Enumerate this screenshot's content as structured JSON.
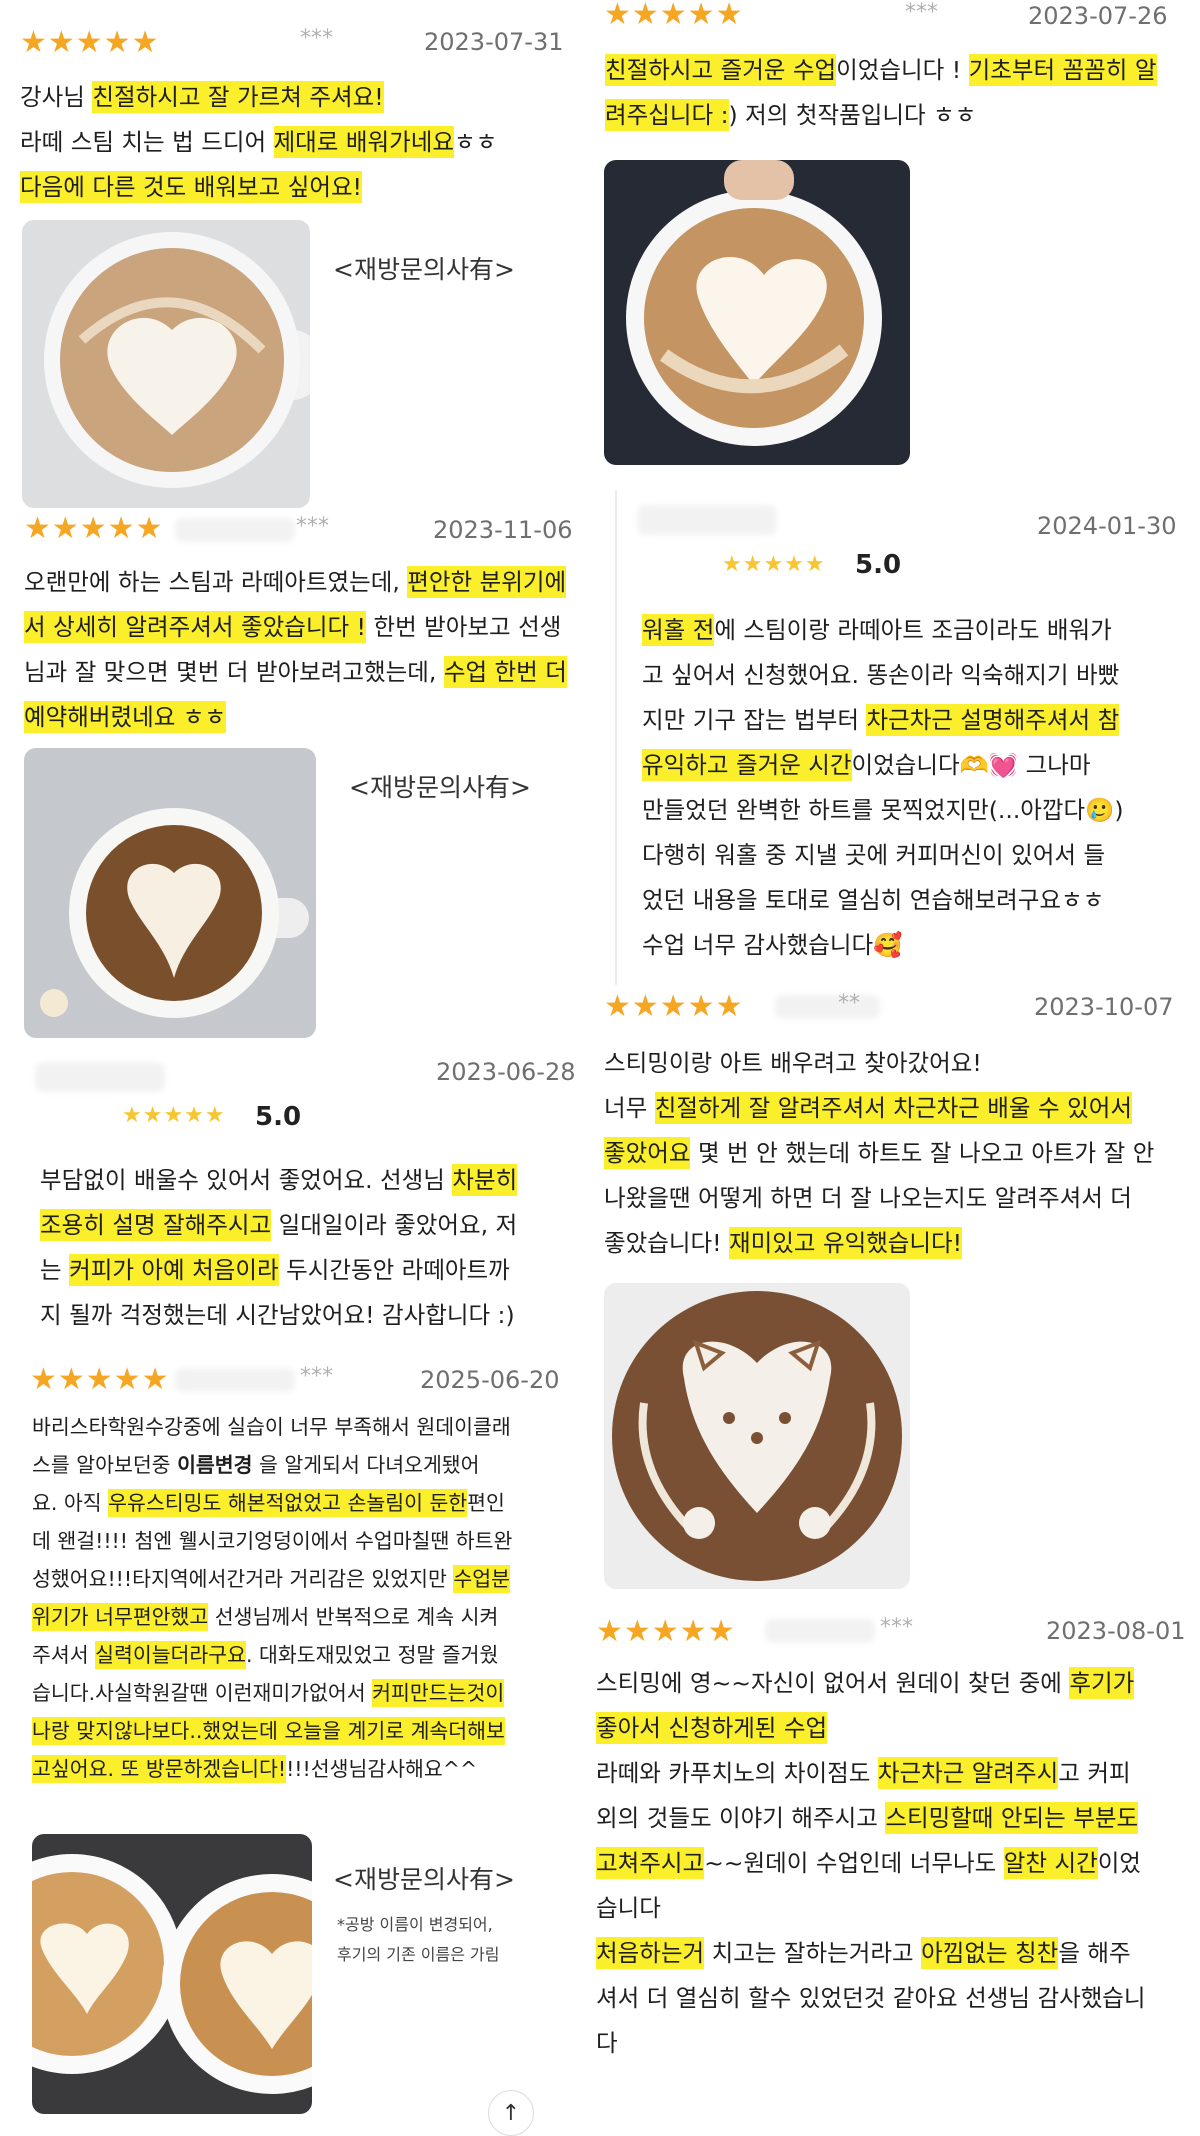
{
  "reviews": [
    {
      "stars": "★★★★★",
      "author": "***",
      "date": "2023-07-31",
      "lines": [
        [
          {
            "t": "강사님 "
          },
          {
            "t": "친절하시고 잘 가르쳐 주셔요!",
            "h": true
          }
        ],
        [
          {
            "t": "라떼 스팀 치는 법 드디어 "
          },
          {
            "t": "제대로 배워가네요",
            "h": true
          },
          {
            "t": "ㅎㅎ"
          }
        ],
        [
          {
            "t": "다음에 다른 것도 배워보고 싶어요!",
            "h": true
          }
        ]
      ],
      "note": "<재방문의사有>"
    },
    {
      "stars": "★★★★★",
      "author": "***",
      "date": "2023-07-26",
      "lines": [
        [
          {
            "t": "친절하시고 즐거운 수업",
            "h": true
          },
          {
            "t": "이었습니다 ! "
          },
          {
            "t": "기초부터 꼼꼼히 알",
            "h": true
          }
        ],
        [
          {
            "t": "려주십니다 :",
            "h": true
          },
          {
            "t": ") 저의 첫작품입니다 ㅎㅎ"
          }
        ]
      ]
    },
    {
      "stars": "★★★★★",
      "author": "***",
      "date": "2023-11-06",
      "lines": [
        [
          {
            "t": "오랜만에 하는 스팀과 라떼아트였는데, "
          },
          {
            "t": "편안한 분위기에",
            "h": true
          }
        ],
        [
          {
            "t": "서 상세히 알려주셔서 좋았습니다 !",
            "h": true
          },
          {
            "t": " 한번 받아보고 선생"
          }
        ],
        [
          {
            "t": "님과 잘 맞으면 몇번 더 받아보려고했는데, "
          },
          {
            "t": "수업 한번 더",
            "h": true
          }
        ],
        [
          {
            "t": "예약해버렸네요 ㅎㅎ",
            "h": true
          }
        ]
      ],
      "note": "<재방문의사有>"
    },
    {
      "stars": "★★★★★",
      "rating": "5.0",
      "date": "2024-01-30",
      "lines": [
        [
          {
            "t": "워홀 전",
            "h": true
          },
          {
            "t": "에 스팀이랑 라떼아트 조금이라도 배워가"
          }
        ],
        [
          {
            "t": "고 싶어서 신청했어요. 똥손이라 익숙해지기 바빴"
          }
        ],
        [
          {
            "t": "지만 기구 잡는 법부터 "
          },
          {
            "t": "차근차근 설명해주셔서 참",
            "h": true
          }
        ],
        [
          {
            "t": "유익하고 즐거운 시간",
            "h": true
          },
          {
            "t": "이었습니다🫶💓 그나마"
          }
        ],
        [
          {
            "t": "만들었던 완벽한 하트를 못찍었지만(...아깝다🥲)"
          }
        ],
        [
          {
            "t": "다행히 워홀 중 지낼 곳에 커피머신이 있어서 들"
          }
        ],
        [
          {
            "t": "었던 내용을 토대로 열심히 연습해보려구요ㅎㅎ"
          }
        ],
        [
          {
            "t": "수업 너무 감사했습니다🥰"
          }
        ]
      ]
    },
    {
      "stars": "★★★★★",
      "author": "**",
      "date": "2023-10-07",
      "lines": [
        [
          {
            "t": "스티밍이랑 아트 배우려고 찾아갔어요!"
          }
        ],
        [
          {
            "t": "너무 "
          },
          {
            "t": "친절하게 잘 알려주셔서 차근차근 배울 수 있어서",
            "h": true
          }
        ],
        [
          {
            "t": "좋았어요",
            "h": true
          },
          {
            "t": " 몇 번 안 했는데 하트도 잘 나오고 아트가 잘 안"
          }
        ],
        [
          {
            "t": "나왔을땐 어떻게 하면 더 잘 나오는지도 알려주셔서 더"
          }
        ],
        [
          {
            "t": "좋았습니다! "
          },
          {
            "t": "재미있고 유익했습니다!",
            "h": true
          }
        ]
      ]
    },
    {
      "stars": "★★★★★",
      "rating": "5.0",
      "date": "2023-06-28",
      "lines": [
        [
          {
            "t": "부담없이 배울수 있어서 좋었어요. 선생님 "
          },
          {
            "t": "차분히",
            "h": true
          }
        ],
        [
          {
            "t": "조용히 설명 잘해주시고",
            "h": true
          },
          {
            "t": " 일대일이라 좋았어요, 저"
          }
        ],
        [
          {
            "t": "는 "
          },
          {
            "t": "커피가 아예 처음이라",
            "h": true
          },
          {
            "t": " 두시간동안 라떼아트까"
          }
        ],
        [
          {
            "t": "지 될까 걱정했는데 시간남았어요! 감사합니다 :)"
          }
        ]
      ]
    },
    {
      "stars": "★★★★★",
      "author": "***",
      "date": "2025-06-20",
      "lines": [
        [
          {
            "t": "바리스타학원수강중에 실습이 너무 부족해서 원데이클래"
          }
        ],
        [
          {
            "t": "스를 알아보던중 "
          },
          {
            "t": "이름변경",
            "b": true
          },
          {
            "t": " 을 알게되서 다녀오게됐어"
          }
        ],
        [
          {
            "t": "요. 아직 "
          },
          {
            "t": "우유스티밍도 해본적없었고 손놀림이 둔한",
            "h": true
          },
          {
            "t": "편인"
          }
        ],
        [
          {
            "t": "데 왠걸!!!! 첨엔 웰시코기엉덩이에서 수업마칠땐 하트완"
          }
        ],
        [
          {
            "t": "성했어요!!!타지역에서간거라 거리감은 있었지만 "
          },
          {
            "t": "수업분",
            "h": true
          }
        ],
        [
          {
            "t": "위기가 너무편안했고",
            "h": true
          },
          {
            "t": " 선생님께서 반복적으로 계속 시켜"
          }
        ],
        [
          {
            "t": "주셔서 "
          },
          {
            "t": "실력이늘더라구요",
            "h": true
          },
          {
            "t": ". 대화도재밌었고 정말 즐거웠"
          }
        ],
        [
          {
            "t": "습니다.사실학원갈땐 이런재미가없어서 "
          },
          {
            "t": "커피만드는것이",
            "h": true
          }
        ],
        [
          {
            "t": "나랑 맞지않나보다..했었는데 오늘을 계기로 계속더해보",
            "h": true
          }
        ],
        [
          {
            "t": "고싶어요. 또 방문하겠습니다!",
            "h": true
          },
          {
            "t": "!!!선생님감사해요^^"
          }
        ]
      ],
      "note": "<재방문의사有>",
      "note2": [
        "*공방 이름이 변경되어,",
        "후기의 기존 이름은 가림"
      ]
    },
    {
      "stars": "★★★★★",
      "author": "***",
      "date": "2023-08-01",
      "lines": [
        [
          {
            "t": "스티밍에 영~~자신이 없어서 원데이 찾던 중에 "
          },
          {
            "t": "후기가",
            "h": true
          }
        ],
        [
          {
            "t": "좋아서 신청하게된 수업",
            "h": true
          }
        ],
        [
          {
            "t": "라떼와 카푸치노의 차이점도 "
          },
          {
            "t": "차근차근 알려주시",
            "h": true
          },
          {
            "t": "고 커피"
          }
        ],
        [
          {
            "t": "외의 것들도 이야기 해주시고 "
          },
          {
            "t": "스티밍할때 안되는 부분도",
            "h": true
          }
        ],
        [
          {
            "t": "고쳐주시고",
            "h": true
          },
          {
            "t": "~~원데이 수업인데 너무나도 "
          },
          {
            "t": "알찬 시간",
            "h": true
          },
          {
            "t": "이었"
          }
        ],
        [
          {
            "t": "습니다"
          }
        ],
        [
          {
            "t": "처음하는거",
            "h": true
          },
          {
            "t": " 치고는 잘하는거라고 "
          },
          {
            "t": "아낌없는 칭찬",
            "h": true
          },
          {
            "t": "을 해주"
          }
        ],
        [
          {
            "t": "셔서 더 열심히 할수 있었던것 같아요 선생님 감사했습니"
          }
        ],
        [
          {
            "t": "다"
          }
        ]
      ]
    }
  ],
  "scroll_top_icon": "↑"
}
